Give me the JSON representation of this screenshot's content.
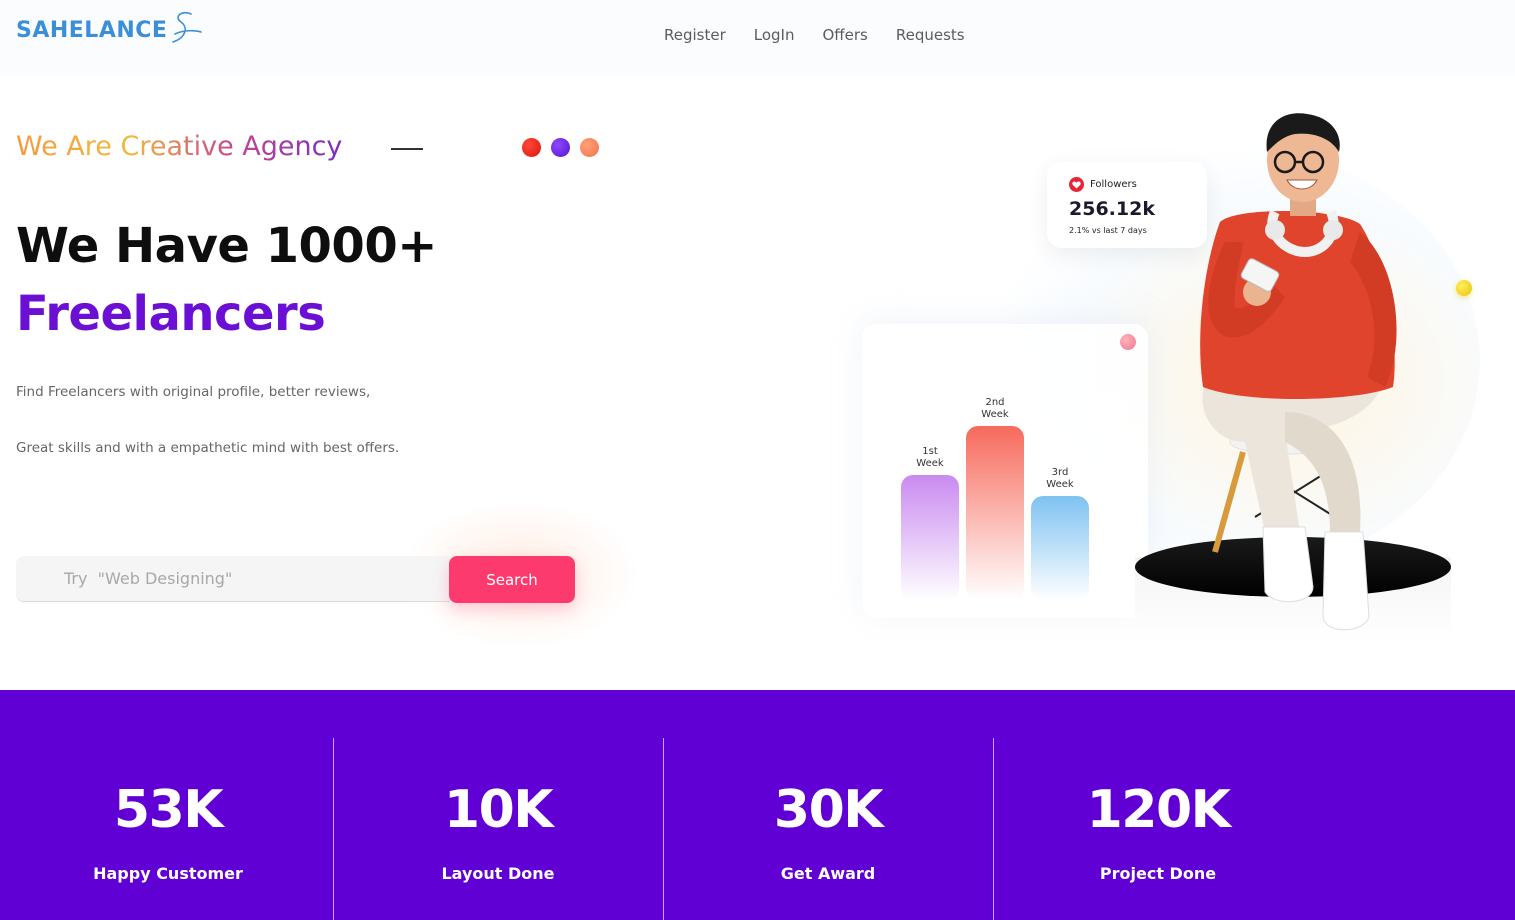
{
  "brand": {
    "name": "SAHELANCE"
  },
  "nav": [
    {
      "label": "Register"
    },
    {
      "label": "LogIn"
    },
    {
      "label": "Offers"
    },
    {
      "label": "Requests"
    }
  ],
  "hero": {
    "tagline": "We Are Creative Agency",
    "headline_line1": "We Have 1000+",
    "headline_line2": "Freelancers",
    "description_line1": "Find Freelancers with original profile, better reviews,",
    "description_line2": "Great skills and with a empathetic mind with best offers.",
    "search": {
      "placeholder": "Try  \"Web Designing\"",
      "value": "",
      "button_label": "Search"
    },
    "dots": [
      "#e8150e",
      "#6a1fe0",
      "#f5825a"
    ]
  },
  "followers_card": {
    "label": "Followers",
    "value": "256.12k",
    "change": "2.1% vs last 7 days",
    "icon": "heart-icon"
  },
  "weekly_chart": {
    "bars": [
      {
        "line1": "1st",
        "line2": "Week",
        "level": 0.72,
        "color_top": "#c98af0",
        "color_bottom": "#ffffff"
      },
      {
        "line1": "2nd",
        "line2": "Week",
        "level": 1.0,
        "color_top": "#f66a5c",
        "color_bottom": "#ffffff"
      },
      {
        "line1": "3rd",
        "line2": "Week",
        "level": 0.6,
        "color_top": "#7ec2f2",
        "color_bottom": "#ffffff"
      }
    ]
  },
  "stats": [
    {
      "value": "53",
      "unit": "K",
      "label": "Happy Customer"
    },
    {
      "value": "10",
      "unit": "K",
      "label": "Layout Done"
    },
    {
      "value": "30",
      "unit": "K",
      "label": "Get Award"
    },
    {
      "value": "120",
      "unit": "K",
      "label": "Project Done"
    }
  ],
  "colors": {
    "accent_purple": "#6a0fd3",
    "stats_background": "#6100d4",
    "search_button": "#fd3a6e",
    "brand_blue": "#3b8fd8"
  }
}
